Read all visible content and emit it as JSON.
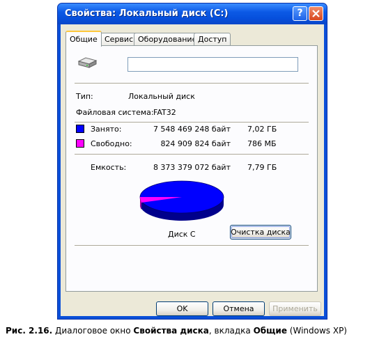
{
  "window": {
    "title": "Свойства: Локальный диск (C:)",
    "help_label": "?"
  },
  "tabs": [
    {
      "label": "Общие",
      "active": true
    },
    {
      "label": "Сервис",
      "active": false
    },
    {
      "label": "Оборудование",
      "active": false
    },
    {
      "label": "Доступ",
      "active": false
    }
  ],
  "general": {
    "icon": "hard-drive-icon",
    "name_value": "",
    "type_label": "Тип:",
    "type_value": "Локальный диск",
    "fs_label": "Файловая система:",
    "fs_value": "FAT32",
    "used": {
      "label": "Занято:",
      "bytes": "7 548 469 248 байт",
      "size": "7,02 ГБ",
      "color": "#0000ff"
    },
    "free": {
      "label": "Свободно:",
      "bytes": "824 909 824 байт",
      "size": "786 МБ",
      "color": "#ff00ff"
    },
    "capacity": {
      "label": "Емкость:",
      "bytes": "8 373 379 072 байт",
      "size": "7,79 ГБ"
    },
    "disk_label": "Диск C",
    "cleanup_button": "Очистка диска"
  },
  "buttons": {
    "ok": "OK",
    "cancel": "Отмена",
    "apply": "Применить"
  },
  "caption": {
    "prefix": "Рис. 2.16.",
    "text1": " Диалоговое окно ",
    "bold1": "Свойства диска",
    "text2": ", вкладка ",
    "bold2": "Общие",
    "text3": " (Windows XP)"
  }
}
